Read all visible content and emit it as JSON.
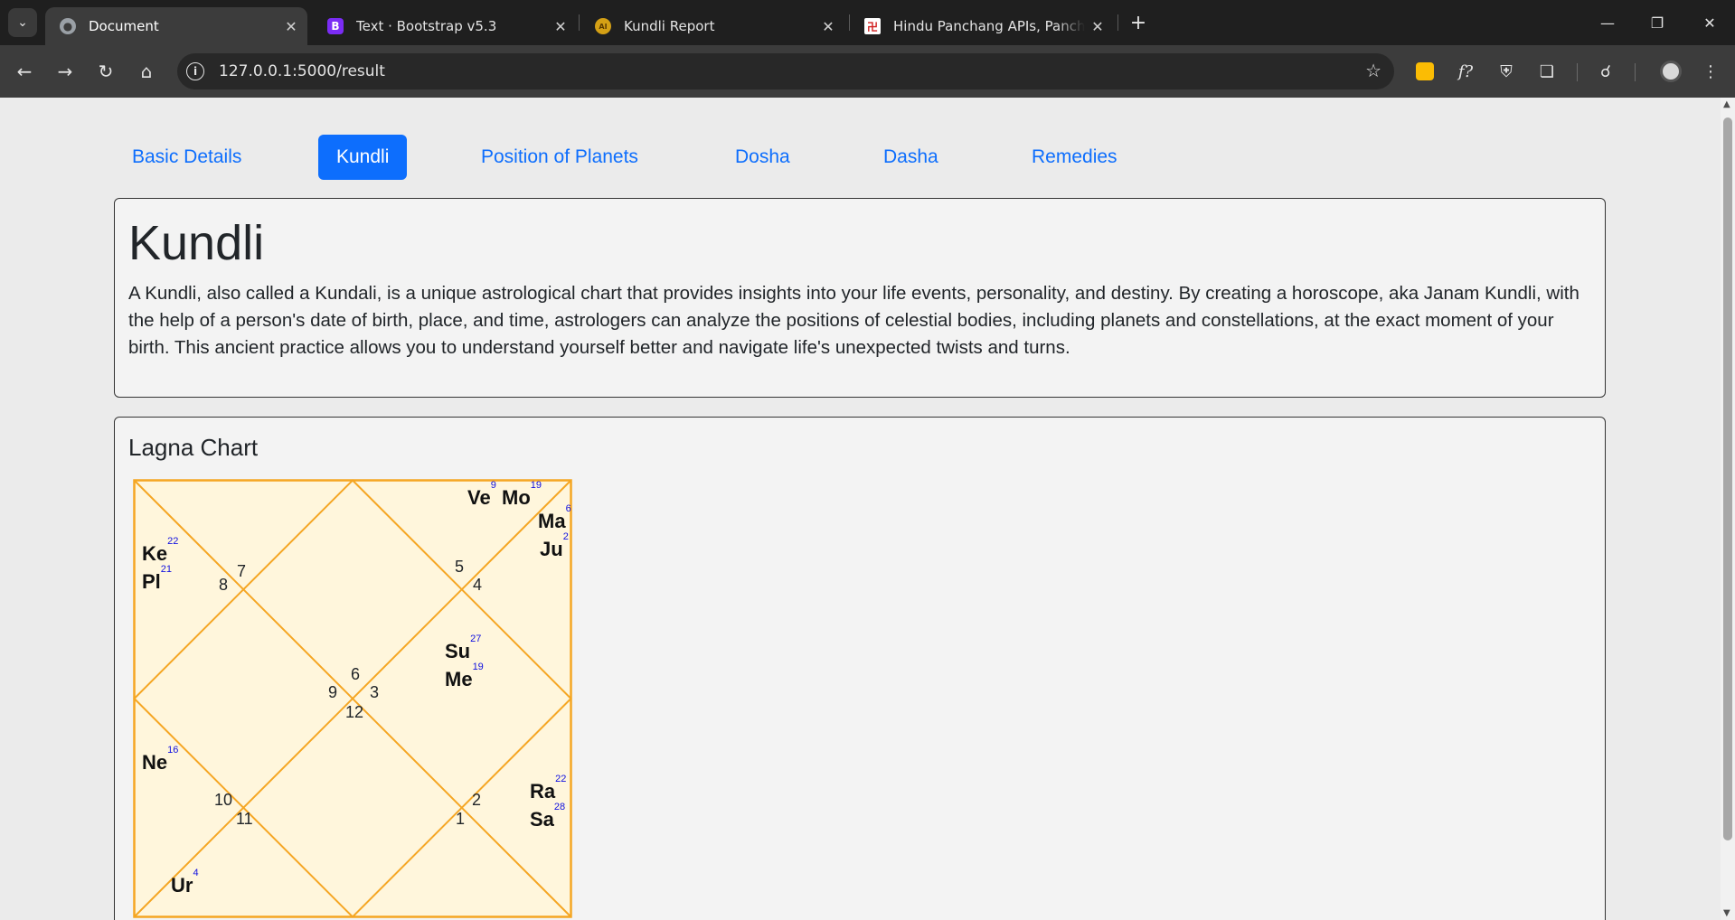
{
  "browser": {
    "tabs": [
      {
        "title": "Document",
        "active": true,
        "icon": "globe-icon"
      },
      {
        "title": "Text · Bootstrap v5.3",
        "active": false,
        "icon": "bootstrap-icon"
      },
      {
        "title": "Kundli Report",
        "active": false,
        "icon": "ai-icon"
      },
      {
        "title": "Hindu Panchang APIs, Panchang",
        "active": false,
        "icon": "swastika-icon"
      }
    ],
    "url": "127.0.0.1:5000/result"
  },
  "nav": {
    "items": [
      "Basic Details",
      "Kundli",
      "Position of Planets",
      "Dosha",
      "Dasha",
      "Remedies"
    ],
    "active": "Kundli"
  },
  "intro": {
    "title": "Kundli",
    "text": "A Kundli, also called a Kundali, is a unique astrological chart that provides insights into your life events, personality, and destiny. By creating a horoscope, aka Janam Kundli, with the help of a person's date of birth, place, and time, astrologers can analyze the positions of celestial bodies, including planets and constellations, at the exact moment of your birth. This ancient practice allows you to understand yourself better and navigate life's unexpected twists and turns."
  },
  "lagna": {
    "title": "Lagna Chart",
    "houses": [
      "6",
      "5",
      "4",
      "7",
      "8",
      "9",
      "3",
      "12",
      "10",
      "11",
      "2",
      "1"
    ],
    "planets": [
      {
        "name": "Ve",
        "deg": "9"
      },
      {
        "name": "Mo",
        "deg": "19"
      },
      {
        "name": "Ma",
        "deg": "6"
      },
      {
        "name": "Ju",
        "deg": "2"
      },
      {
        "name": "Ke",
        "deg": "22"
      },
      {
        "name": "Pl",
        "deg": "21"
      },
      {
        "name": "Su",
        "deg": "27"
      },
      {
        "name": "Me",
        "deg": "19"
      },
      {
        "name": "Ne",
        "deg": "16"
      },
      {
        "name": "Ra",
        "deg": "22"
      },
      {
        "name": "Sa",
        "deg": "28"
      },
      {
        "name": "Ur",
        "deg": "4"
      }
    ],
    "colors": {
      "fill": "#fff6dc",
      "line": "#f5a623"
    }
  }
}
